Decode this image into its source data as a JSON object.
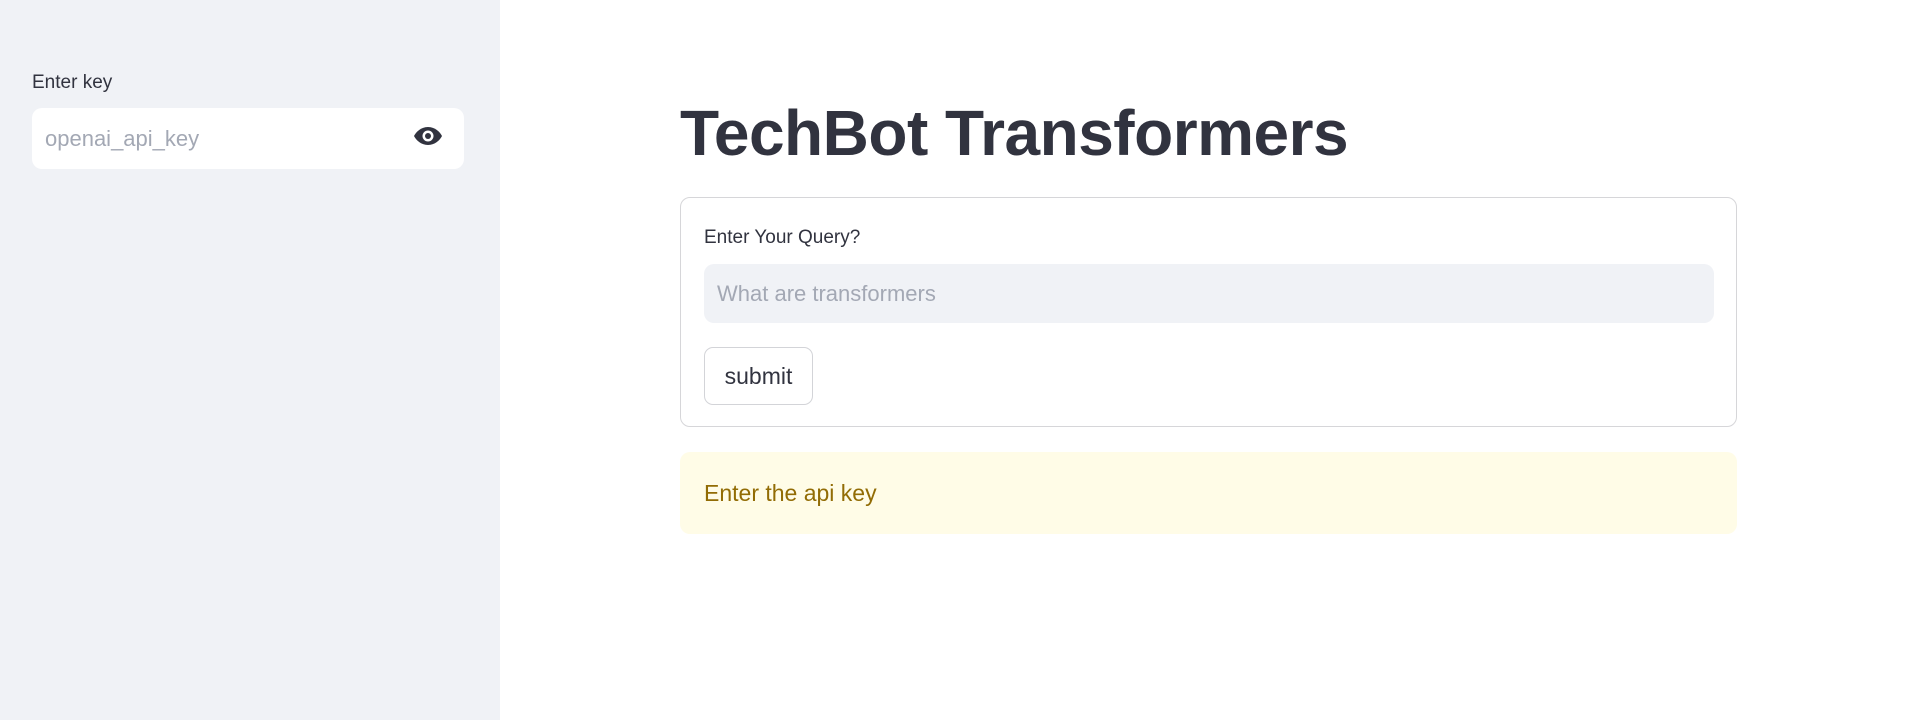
{
  "sidebar": {
    "key_label": "Enter key",
    "key_placeholder": "openai_api_key",
    "key_value": "",
    "visibility_icon": "eye-icon"
  },
  "main": {
    "title": "TechBot Transformers",
    "form": {
      "query_label": "Enter Your Query?",
      "query_placeholder": "What are transformers",
      "query_value": "",
      "submit_label": "submit"
    },
    "alert": {
      "message": "Enter the api key",
      "background_color": "#fffce7",
      "text_color": "#926c05"
    }
  },
  "colors": {
    "sidebar_bg": "#f0f2f6",
    "text": "#31333f",
    "placeholder": "#a3a8b4"
  }
}
